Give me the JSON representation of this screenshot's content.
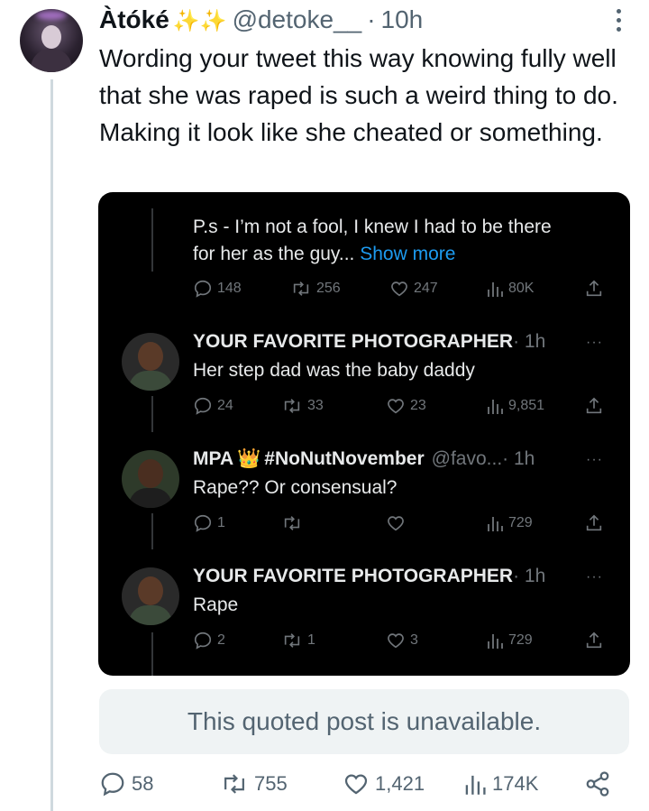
{
  "tweet": {
    "name": "Àtóké",
    "sparkles": "✨✨",
    "handle": "@detoke__",
    "separator": "·",
    "time": "10h",
    "text": "Wording your tweet this way knowing fully well that she was raped is such a weird thing to do. Making it look like she cheated or something.",
    "actions": {
      "replies": "58",
      "reposts": "755",
      "likes": "1,421",
      "views": "174K"
    }
  },
  "quoted_screenshot": {
    "top_post": {
      "line1": "P.s - I’m not a fool, I knew I had to be there",
      "line2": "for her as the guy...",
      "show_more": "Show more",
      "actions": {
        "replies": "148",
        "reposts": "256",
        "likes": "247",
        "views": "80K"
      }
    },
    "replies": [
      {
        "name": "YOUR FAVORITE PHOTOGRAPHER",
        "meta": "· 1h",
        "text": "Her step dad was the baby daddy",
        "actions": {
          "replies": "24",
          "reposts": "33",
          "likes": "23",
          "views": "9,851"
        }
      },
      {
        "name": "MPA",
        "crown": "👑",
        "hashtag": "#NoNutNovember",
        "handle": "@favo...",
        "meta": "· 1h",
        "text": "Rape?? Or consensual?",
        "actions": {
          "replies": "1",
          "reposts": "",
          "likes": "",
          "views": "729"
        }
      },
      {
        "name": "YOUR FAVORITE PHOTOGRAPHER",
        "meta": "· 1h",
        "text": "Rape",
        "actions": {
          "replies": "2",
          "reposts": "1",
          "likes": "3",
          "views": "729"
        }
      }
    ],
    "more_label": "···"
  },
  "unavailable_notice": "This quoted post is unavailable.",
  "colors": {
    "link": "#1d9bf0",
    "secondary_text": "#536471",
    "dark_bg": "#000000"
  }
}
